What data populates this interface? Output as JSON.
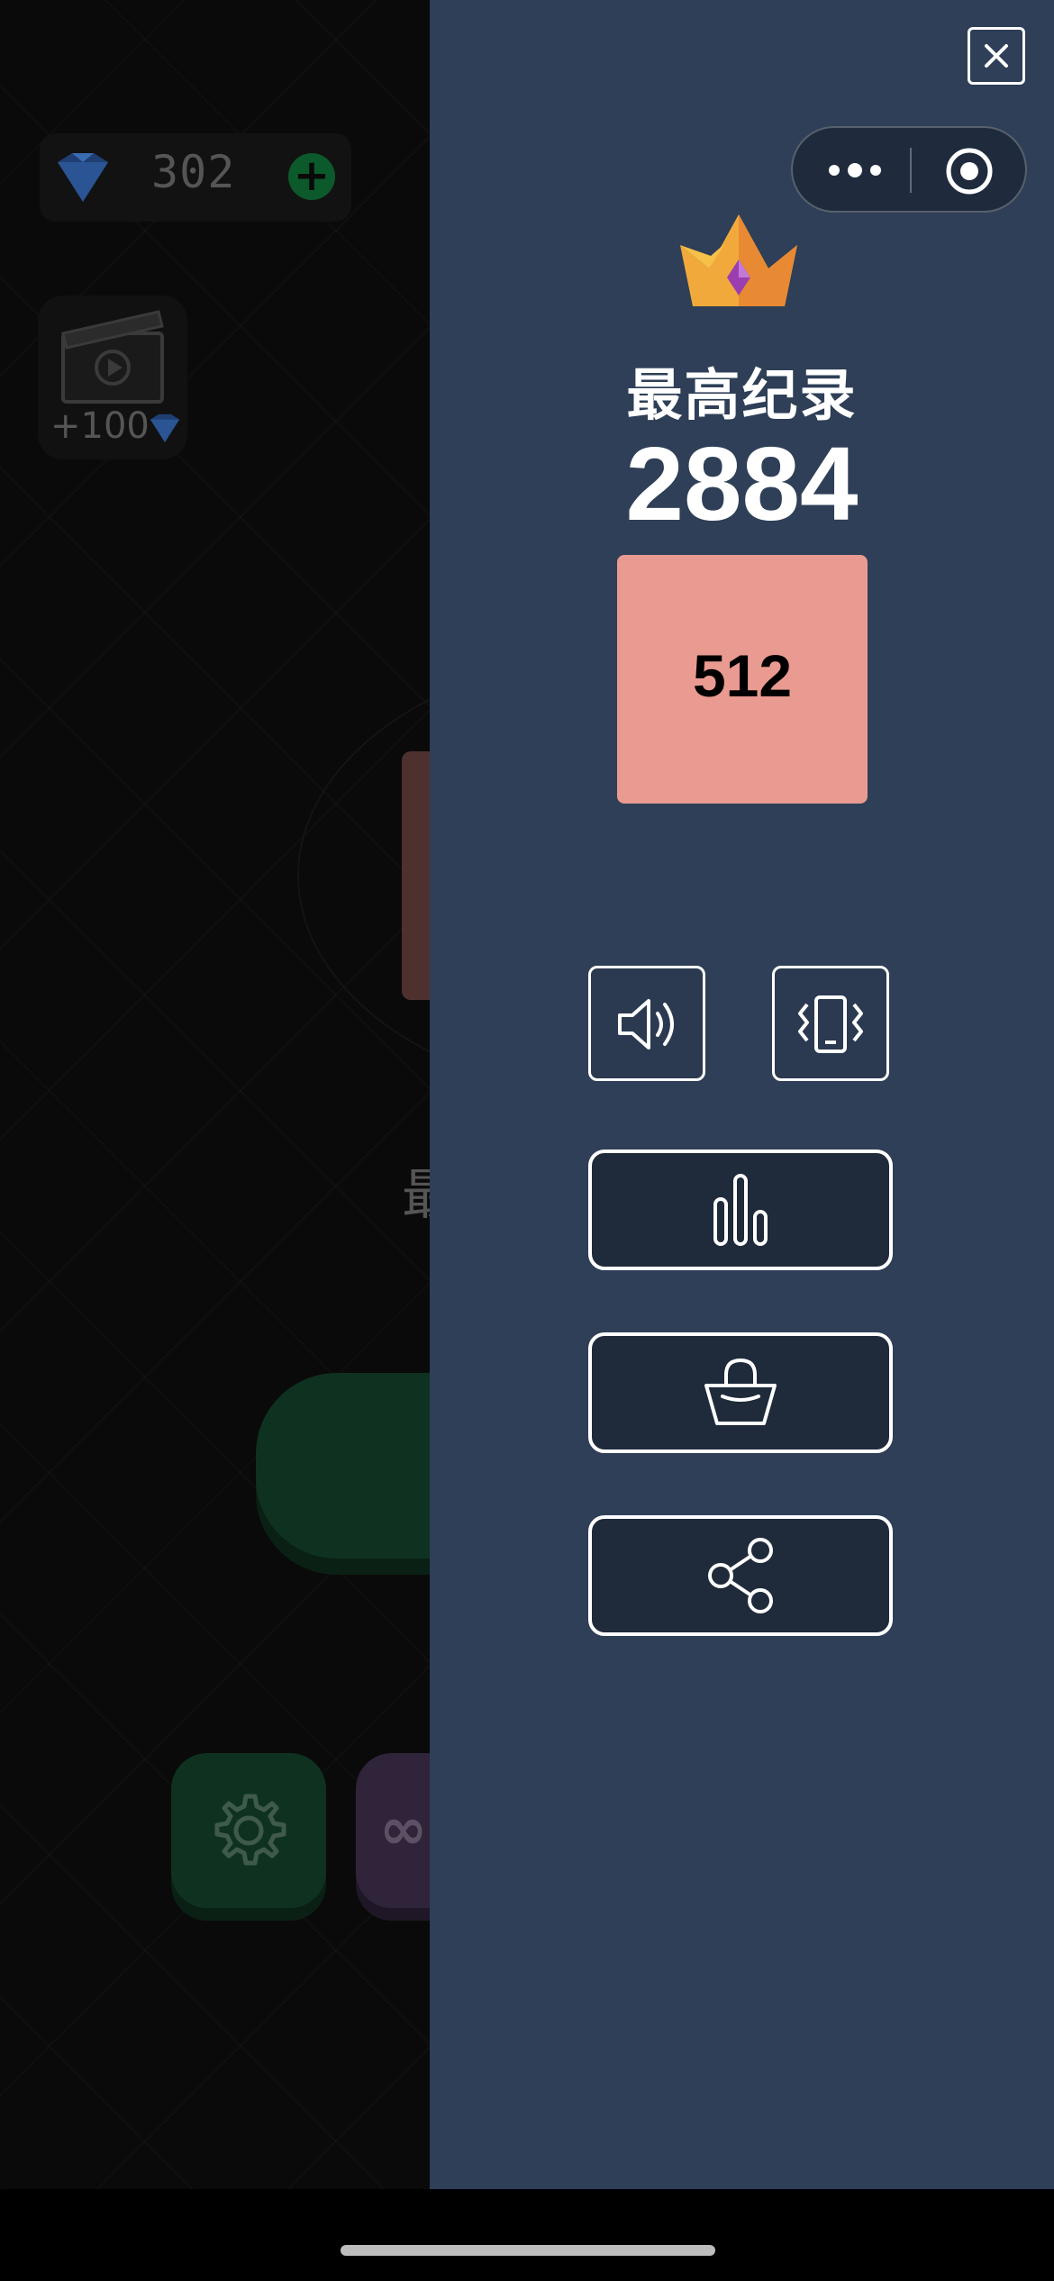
{
  "background": {
    "gem_count": "302",
    "video_reward": "+100",
    "partial_text": "最"
  },
  "panel": {
    "record_label": "最高纪录",
    "record_score": "2884",
    "best_tile_value": "512",
    "icons": {
      "close": "close-icon",
      "menu": "more-dots-icon",
      "target": "target-icon",
      "crown": "crown-icon",
      "sound": "speaker-icon",
      "vibration": "vibration-icon",
      "leaderboard": "bar-chart-icon",
      "shop": "shopping-basket-icon",
      "share": "share-icon"
    }
  },
  "colors": {
    "panel_bg": "#2e3f57",
    "tile_512": "#e99a91",
    "button_bg": "#1f2a3b",
    "text": "#ffffff"
  }
}
